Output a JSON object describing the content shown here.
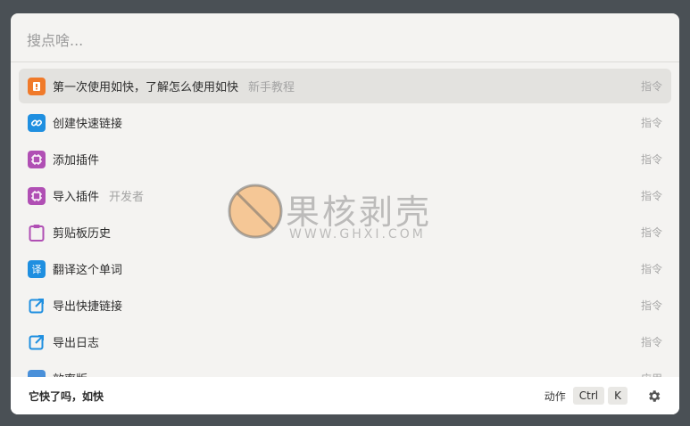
{
  "search": {
    "placeholder": "搜点啥...",
    "value": ""
  },
  "items": [
    {
      "title": "第一次使用如快，了解怎么使用如快",
      "subtitle": "新手教程",
      "type": "指令",
      "icon": "tutorial-icon",
      "icon_color": "#f07a2a",
      "selected": true
    },
    {
      "title": "创建快速链接",
      "subtitle": "",
      "type": "指令",
      "icon": "link-icon",
      "icon_color": "#1f8fe0",
      "selected": false
    },
    {
      "title": "添加插件",
      "subtitle": "",
      "type": "指令",
      "icon": "plugin-icon",
      "icon_color": "#b04fb4",
      "selected": false
    },
    {
      "title": "导入插件",
      "subtitle": "开发者",
      "type": "指令",
      "icon": "plugin-icon",
      "icon_color": "#b04fb4",
      "selected": false
    },
    {
      "title": "剪贴板历史",
      "subtitle": "",
      "type": "指令",
      "icon": "clipboard-icon",
      "icon_color": "#b04fb4",
      "selected": false
    },
    {
      "title": "翻译这个单词",
      "subtitle": "",
      "type": "指令",
      "icon": "translate-icon",
      "icon_color": "#1f8fe0",
      "selected": false
    },
    {
      "title": "导出快捷链接",
      "subtitle": "",
      "type": "指令",
      "icon": "export-icon",
      "icon_color": "#1f8fe0",
      "selected": false
    },
    {
      "title": "导出日志",
      "subtitle": "",
      "type": "指令",
      "icon": "export-icon",
      "icon_color": "#1f8fe0",
      "selected": false
    },
    {
      "title": "效率版",
      "subtitle": "",
      "type": "应用",
      "icon": "app-icon",
      "icon_color": "#4a90d9",
      "selected": false
    }
  ],
  "translate_glyph": "译",
  "footer": {
    "message": "它快了吗，如快",
    "action_label": "动作",
    "keys": [
      "Ctrl",
      "K"
    ]
  },
  "watermark": {
    "title": "果核剥壳",
    "url": "WWW.GHXI.COM"
  }
}
